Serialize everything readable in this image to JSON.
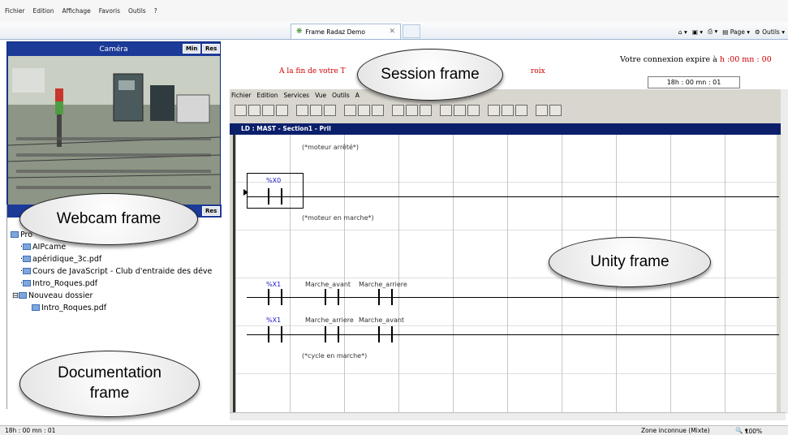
{
  "browser": {
    "menu": [
      "Fichier",
      "Edition",
      "Affichage",
      "Favoris",
      "Outils",
      "?"
    ],
    "tab_title": "Frame Radaz Demo",
    "tools": [
      "Page",
      "Outils"
    ],
    "status_left": "18h : 00 mn : 01",
    "status_zone": "Zone inconnue (Mixte)",
    "status_zoom": "100%"
  },
  "camera": {
    "title": "Caméra",
    "btn_min": "Min",
    "btn_res": "Res"
  },
  "documentation": {
    "btn_res": "Res",
    "tree": [
      {
        "label": "Pro"
      },
      {
        "label": "AIPcame"
      },
      {
        "label": "apéridique_3c.pdf"
      },
      {
        "label": "Cours de JavaScript - Club d'entraide des déve"
      },
      {
        "label": "Intro_Roques.pdf"
      },
      {
        "label": "Nouveau dossier"
      },
      {
        "label": "Intro_Roques.pdf"
      }
    ]
  },
  "session": {
    "red_left": "A la fin de votre T",
    "red_right": "roix",
    "expire_label": "Votre connexion expire à",
    "expire_time": "h :00 mn : 00",
    "time_field": "18h : 00 mn : 01"
  },
  "unity": {
    "menu": [
      "Fichier",
      "Edition",
      "Services",
      "Vue",
      "Outils",
      "A"
    ],
    "ld_title": "LD : MAST - Section1 - Pril",
    "comment1": "(*moteur arrêté*)",
    "comment2": "(*moteur en marche*)",
    "comment3": "(*cycle en marche*)",
    "var_x0": "%X0",
    "var_x1": "%X1",
    "var_x1b": "%X1",
    "marche_avant": "Marche_avant",
    "marche_arriere": "Marche_arriere",
    "marche_arriere2": "Marche_arriere",
    "marche_avant2": "Marche_avant"
  },
  "annotations": {
    "session": "Session frame",
    "webcam": "Webcam frame",
    "unity": "Unity frame",
    "documentation": "Documentation frame"
  }
}
